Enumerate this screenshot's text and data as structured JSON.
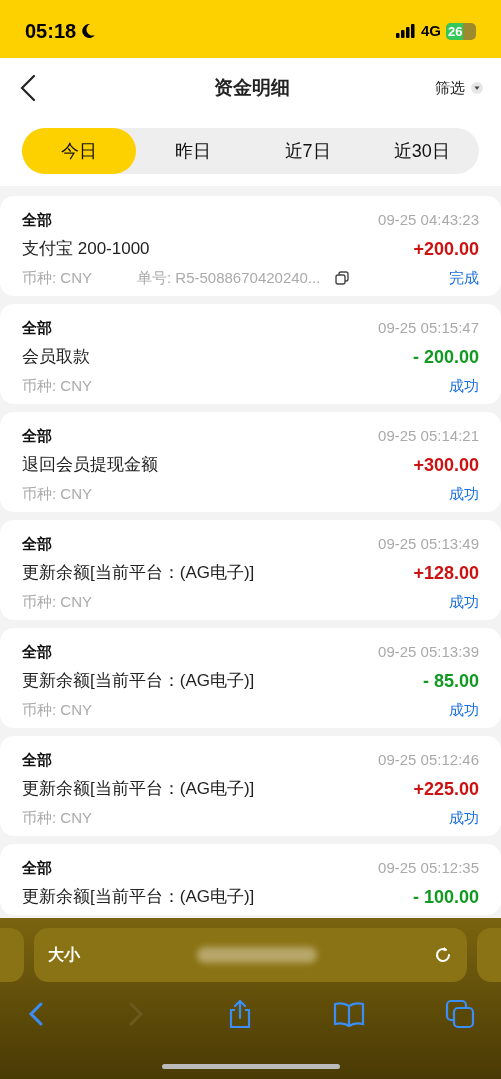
{
  "status_bar": {
    "time": "05:18",
    "network": "4G",
    "battery": "26"
  },
  "header": {
    "title": "资金明细",
    "filter": "筛选"
  },
  "tabs": [
    {
      "label": "今日",
      "selected": true
    },
    {
      "label": "昨日",
      "selected": false
    },
    {
      "label": "近7日",
      "selected": false
    },
    {
      "label": "近30日",
      "selected": false
    }
  ],
  "records": [
    {
      "category": "全部",
      "time": "09-25 04:43:23",
      "title": "支付宝 200-1000",
      "amount": "+200.00",
      "color": "#cc1111",
      "currency": "币种: CNY",
      "order": "单号: R5-5088670420240...",
      "status": "完成"
    },
    {
      "category": "全部",
      "time": "09-25 05:15:47",
      "title": "会员取款",
      "amount": "- 200.00",
      "color": "#119922",
      "currency": "币种: CNY",
      "status": "成功"
    },
    {
      "category": "全部",
      "time": "09-25 05:14:21",
      "title": "退回会员提现金额",
      "amount": "+300.00",
      "color": "#cc1111",
      "currency": "币种: CNY",
      "status": "成功"
    },
    {
      "category": "全部",
      "time": "09-25 05:13:49",
      "title": "更新余额[当前平台：(AG电子)]",
      "amount": "+128.00",
      "color": "#cc1111",
      "currency": "币种: CNY",
      "status": "成功"
    },
    {
      "category": "全部",
      "time": "09-25 05:13:39",
      "title": "更新余额[当前平台：(AG电子)]",
      "amount": "- 85.00",
      "color": "#119922",
      "currency": "币种: CNY",
      "status": "成功"
    },
    {
      "category": "全部",
      "time": "09-25 05:12:46",
      "title": "更新余额[当前平台：(AG电子)]",
      "amount": "+225.00",
      "color": "#cc1111",
      "currency": "币种: CNY",
      "status": "成功"
    },
    {
      "category": "全部",
      "time": "09-25 05:12:35",
      "title": "更新余额[当前平台：(AG电子)]",
      "amount": "- 100.00",
      "color": "#119922"
    }
  ],
  "browser": {
    "text_size": "大小"
  }
}
